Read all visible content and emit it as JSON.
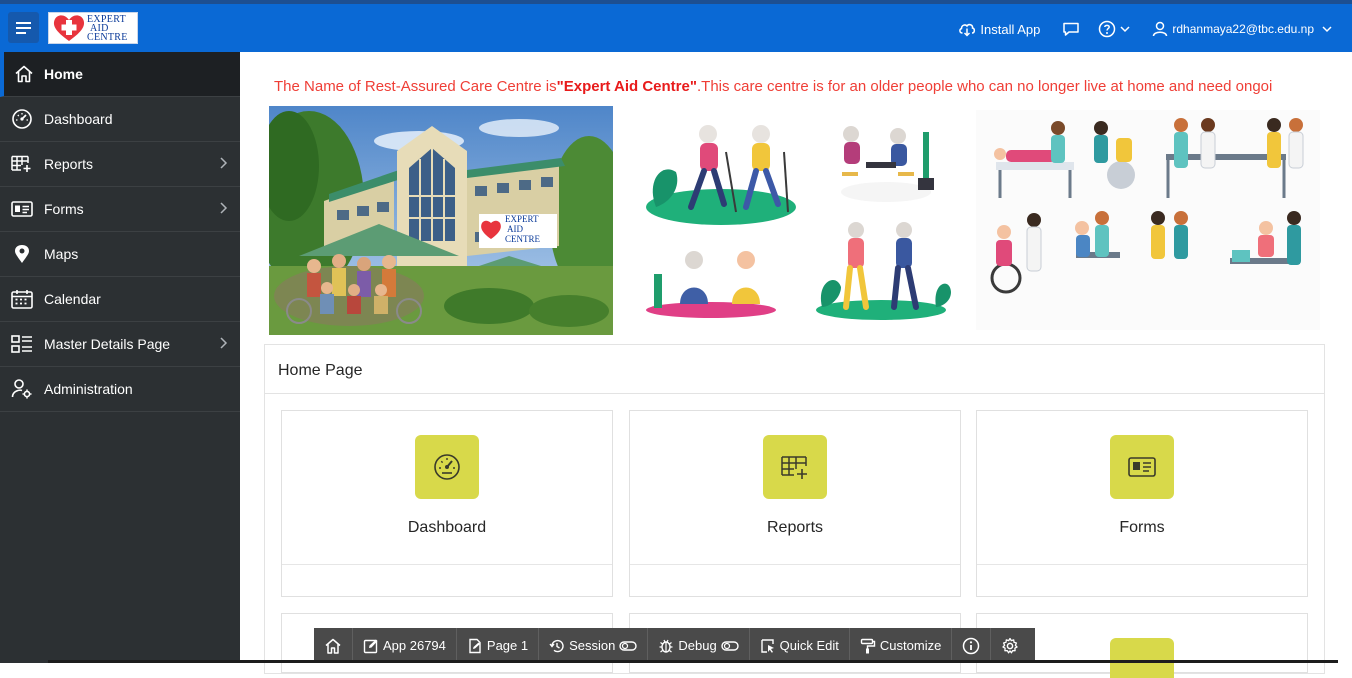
{
  "header": {
    "logo_text": [
      "EXPERT",
      "AID",
      "CENTRE"
    ],
    "install_label": "Install App",
    "user_email": "rdhanmaya22@tbc.edu.np"
  },
  "sidebar": {
    "items": [
      {
        "label": "Home",
        "icon": "home-icon",
        "active": true
      },
      {
        "label": "Dashboard",
        "icon": "dashboard-icon"
      },
      {
        "label": "Reports",
        "icon": "reports-icon",
        "chevron": true
      },
      {
        "label": "Forms",
        "icon": "forms-icon",
        "chevron": true
      },
      {
        "label": "Maps",
        "icon": "map-pin-icon"
      },
      {
        "label": "Calendar",
        "icon": "calendar-icon"
      },
      {
        "label": "Master Details Page",
        "icon": "master-details-icon",
        "chevron": true
      },
      {
        "label": "Administration",
        "icon": "administration-icon"
      }
    ]
  },
  "banner": {
    "prefix": "The Name of Rest-Assured Care Centre is",
    "name": "\"Expert Aid Centre\"",
    "suffix": ".This care centre is for an older people who can no longer live at home and need ongoi"
  },
  "photo_sign": [
    "EXPERT",
    "AID",
    "CENTRE"
  ],
  "panel": {
    "title": "Home Page",
    "cards": [
      {
        "label": "Dashboard",
        "icon": "dashboard-icon"
      },
      {
        "label": "Reports",
        "icon": "reports-icon"
      },
      {
        "label": "Forms",
        "icon": "forms-icon"
      }
    ]
  },
  "devbar": {
    "app": "App 26794",
    "page": "Page 1",
    "session": "Session",
    "debug": "Debug",
    "quick_edit": "Quick Edit",
    "customize": "Customize"
  },
  "colors": {
    "header": "#0a69d5",
    "sidebar": "#2c3033",
    "tile": "#d8d94a",
    "banner_text": "#ef3e36"
  }
}
